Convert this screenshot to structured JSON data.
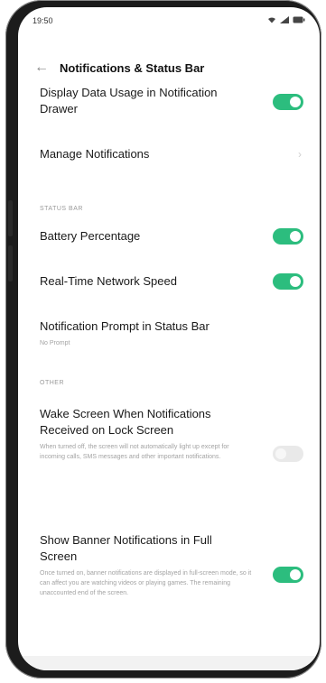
{
  "status_bar": {
    "time": "19:50",
    "wifi": "wifi-icon",
    "signal": "signal-icon",
    "battery": "battery-icon"
  },
  "nav": {
    "back_icon": "back-arrow-icon",
    "title": "Notifications & Status Bar"
  },
  "top_row": {
    "title": "Display Data Usage in Notification Drawer",
    "toggle_on": true
  },
  "manage": {
    "title": "Manage Notifications",
    "chevron": "chevron-right-icon"
  },
  "status_bar_section": {
    "header": "STATUS BAR",
    "battery": {
      "title": "Battery Percentage",
      "toggle_on": true
    },
    "network": {
      "title": "Real-Time Network Speed",
      "toggle_on": true
    },
    "prompt": {
      "title": "Notification Prompt in Status Bar",
      "value": "No Prompt"
    }
  },
  "other_section": {
    "header": "OTHER",
    "wake": {
      "title": "Wake Screen When Notifications Received on Lock Screen",
      "desc": "When turned off, the screen will not automatically light up except for incoming calls, SMS messages and other important notifications.",
      "toggle_on": false
    },
    "banner": {
      "title": "Show Banner Notifications in Full Screen",
      "desc": "Once turned on, banner notifications are displayed in full-screen mode, so it can affect you are watching videos or playing games. The remaining unaccounted end of the screen.",
      "toggle_on": true
    }
  },
  "colors": {
    "accent": "#2cbd7e",
    "toggle_off": "#e9e9e9"
  }
}
